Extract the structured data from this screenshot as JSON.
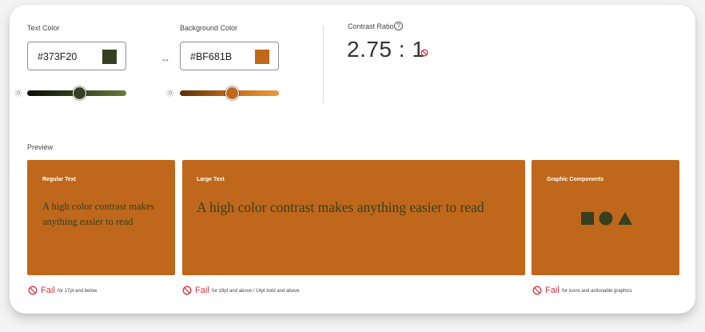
{
  "text_color": {
    "label": "Text Color",
    "value": "#373F20",
    "swatch": "#373F20",
    "slider_gradient": [
      "#0b0d06",
      "#373F20",
      "#6a7a3c"
    ],
    "slider_position": 0.53
  },
  "swap_glyph": "↔",
  "background_color": {
    "label": "Background Color",
    "value": "#BF681B",
    "swatch": "#BF681B",
    "slider_gradient": [
      "#5a3008",
      "#BF681B",
      "#f09a3e"
    ],
    "slider_position": 0.53
  },
  "contrast": {
    "label": "Contrast Ratio",
    "help_glyph": "?",
    "value": "2.75 : 1",
    "status": "fail",
    "fail_color": "#d7373f"
  },
  "preview": {
    "label": "Preview",
    "bg_color": "#BF681B",
    "text_color": "#373F20",
    "regular": {
      "title": "Regular Text",
      "text": "A high color contrast makes anything easier to read"
    },
    "large": {
      "title": "Large Text",
      "text": "A high color contrast makes anything easier to read"
    },
    "graphic": {
      "title": "Graphic Components",
      "shapes": [
        "square",
        "circle",
        "triangle"
      ]
    }
  },
  "results": [
    {
      "word": "Fail",
      "desc": "for 17pt and below"
    },
    {
      "word": "Fail",
      "desc": "for 18pt and above / 14pt bold and above"
    },
    {
      "word": "Fail",
      "desc": "for icons and actionable graphics"
    }
  ]
}
